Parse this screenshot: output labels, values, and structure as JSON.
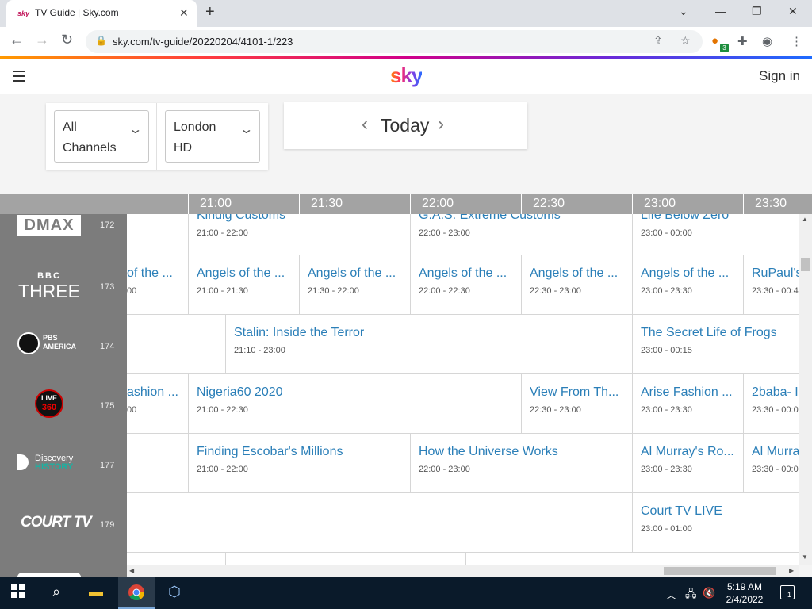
{
  "browser": {
    "tab_title": "TV Guide | Sky.com",
    "tab_favicon": "sky",
    "url": "sky.com/tv-guide/20220204/4101-1/223",
    "extension_badge": "3"
  },
  "header": {
    "logo": "sky",
    "signin": "Sign in"
  },
  "filters": {
    "channels_line1": "All",
    "channels_line2": "Channels",
    "region_line1": "London",
    "region_line2": "HD",
    "date": "Today"
  },
  "times": [
    "21:00",
    "21:30",
    "22:00",
    "22:30",
    "23:00",
    "23:30"
  ],
  "channels": [
    {
      "logo": "DMAX",
      "number": "172"
    },
    {
      "logo": "BBC THREE",
      "logo_top": "BBC",
      "logo_bottom": "THREE",
      "number": "173"
    },
    {
      "logo": "PBS AMERICA",
      "logo_top": "PBS",
      "logo_bottom": "AMERICA",
      "number": "174"
    },
    {
      "logo": "LIVE 360",
      "logo_top": "LIVE",
      "logo_bottom": "360",
      "number": "175"
    },
    {
      "logo": "Discovery HISTORY",
      "logo_top": "Discovery",
      "logo_bottom": "HISTORY",
      "number": "177"
    },
    {
      "logo": "COURT TV",
      "number": "179"
    }
  ],
  "programs": {
    "r0": [
      {
        "title": "",
        "time": ""
      },
      {
        "title": "Kindig Customs",
        "time": "21:00 - 22:00"
      },
      {
        "title": "G.A.S. Extreme Customs",
        "time": "22:00 - 23:00"
      },
      {
        "title": "Life Below Zero",
        "time": "23:00 - 00:00"
      }
    ],
    "r1": [
      {
        "title": "of the ...",
        "time": "00"
      },
      {
        "title": "Angels of the ...",
        "time": "21:00 - 21:30"
      },
      {
        "title": "Angels of the ...",
        "time": "21:30 - 22:00"
      },
      {
        "title": "Angels of the ...",
        "time": "22:00 - 22:30"
      },
      {
        "title": "Angels of the ...",
        "time": "22:30 - 23:00"
      },
      {
        "title": "Angels of the ...",
        "time": "23:00 - 23:30"
      },
      {
        "title": "RuPaul's",
        "time": "23:30 - 00:4"
      }
    ],
    "r2": [
      {
        "title": "",
        "time": ""
      },
      {
        "title": "Stalin: Inside the Terror",
        "time": "21:10 - 23:00"
      },
      {
        "title": "The Secret Life of Frogs",
        "time": "23:00 - 00:15"
      }
    ],
    "r3": [
      {
        "title": "ashion ...",
        "time": "00"
      },
      {
        "title": "Nigeria60 2020",
        "time": "21:00 - 22:30"
      },
      {
        "title": "View From Th...",
        "time": "22:30 - 23:00"
      },
      {
        "title": "Arise Fashion ...",
        "time": "23:00 - 23:30"
      },
      {
        "title": "2baba- I",
        "time": "23:30 - 00:0"
      }
    ],
    "r4": [
      {
        "title": "",
        "time": ""
      },
      {
        "title": "Finding Escobar's Millions",
        "time": "21:00 - 22:00"
      },
      {
        "title": "How the Universe Works",
        "time": "22:00 - 23:00"
      },
      {
        "title": "Al Murray's Ro...",
        "time": "23:00 - 23:30"
      },
      {
        "title": "Al Murra",
        "time": "23:30 - 00:0"
      }
    ],
    "r5": [
      {
        "title": "",
        "time": ""
      },
      {
        "title": "Court TV LIVE",
        "time": "23:00 - 01:00"
      }
    ]
  },
  "taskbar": {
    "time": "5:19 AM",
    "date": "2/4/2022",
    "notifications": "1"
  }
}
